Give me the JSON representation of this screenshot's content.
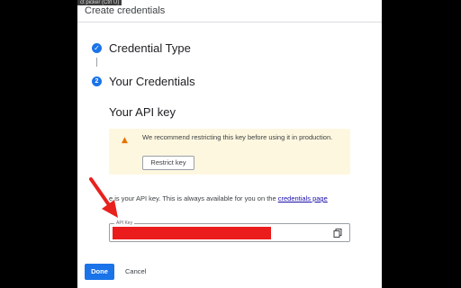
{
  "tooltip": "ct picker (Ctrl U)",
  "dialog": {
    "title": "Create credentials"
  },
  "steps": [
    {
      "icon": "check-icon",
      "label": "Credential Type"
    },
    {
      "number": "2",
      "label": "Your Credentials"
    }
  ],
  "section": {
    "title": "Your API key"
  },
  "warning": {
    "icon": "warning-icon",
    "text": "We recommend restricting this key before using it in production.",
    "button": "Restrict key"
  },
  "info": {
    "prefix": "e is your API key. This is always available for you on the ",
    "link": "credentials page"
  },
  "api_key_field": {
    "label": "API Key",
    "value_redacted": true,
    "copy_icon": "copy-icon"
  },
  "footer": {
    "done": "Done",
    "cancel": "Cancel"
  },
  "colors": {
    "accent": "#1a73e8",
    "warning_bg": "#fef7e0",
    "warning_icon": "#e37400",
    "redaction": "#ea1c1c",
    "annotation_arrow": "#e8211d"
  }
}
